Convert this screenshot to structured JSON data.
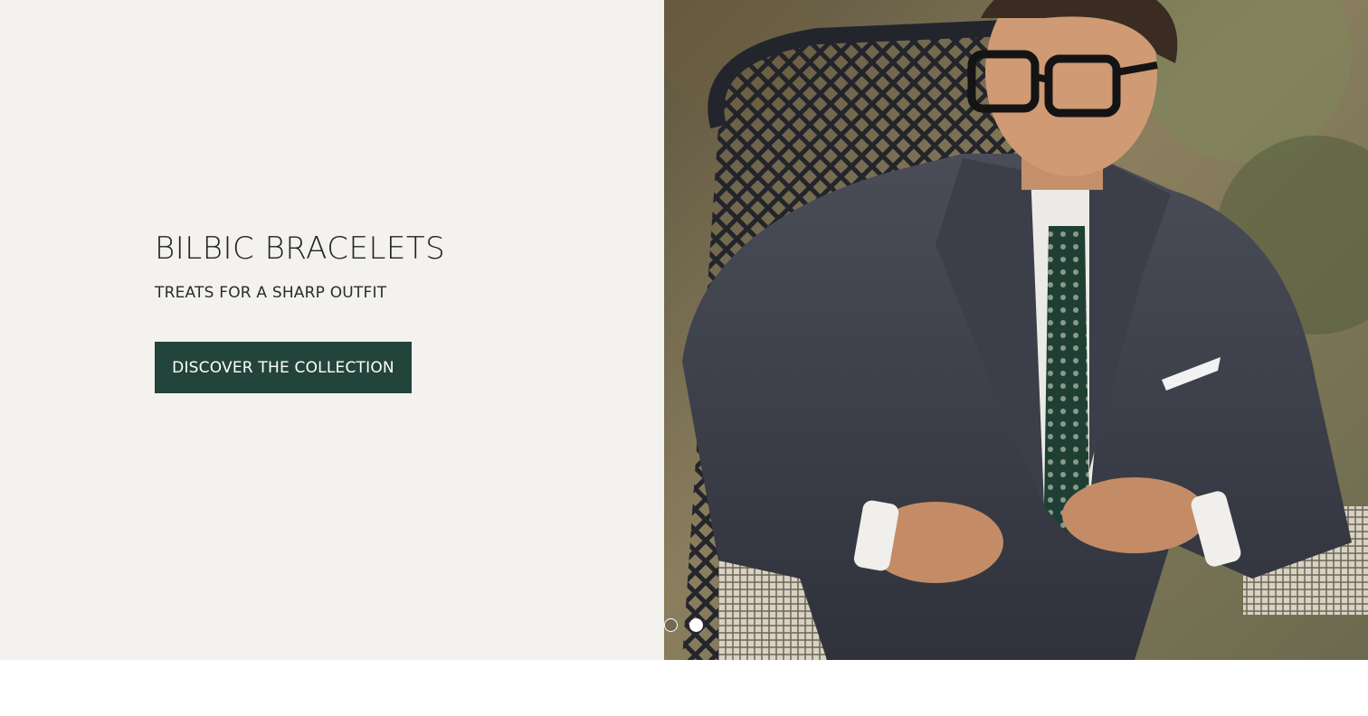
{
  "hero": {
    "title": "BILBIC BRACELETS",
    "subtitle": "TREATS FOR A SHARP OUTFIT",
    "cta_label": "DISCOVER THE COLLECTION",
    "background_color": "#f3f2ef",
    "button_color": "#23443a"
  },
  "image": {
    "alt": "Man in a dark grey suit, white shirt, green patterned tie and black glasses, seated on a woven chair outdoors"
  },
  "carousel": {
    "slide_count": 2,
    "active_index": 2
  }
}
